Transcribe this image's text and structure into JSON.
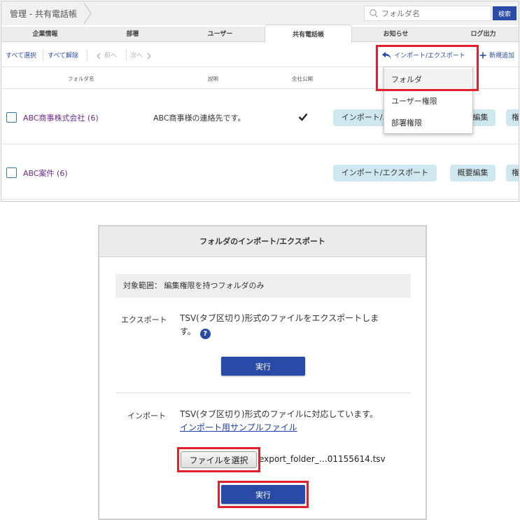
{
  "breadcrumb": "管理 - 共有電話帳",
  "search": {
    "placeholder": "フォルダ名",
    "button": "検索"
  },
  "tabs": [
    {
      "label": "企業情報"
    },
    {
      "label": "部署"
    },
    {
      "label": "ユーザー"
    },
    {
      "label": "共有電話帳",
      "active": true
    },
    {
      "label": "お知らせ"
    },
    {
      "label": "ログ出力"
    }
  ],
  "toolbar": {
    "select_all": "すべて選択",
    "deselect_all": "すべて解除",
    "prev": "前へ",
    "next": "次へ",
    "import_export": "インポート/エクスポート",
    "add_new": "新規追加"
  },
  "columns": {
    "folder_name": "フォルダ名",
    "description": "説明",
    "company_public": "全社公開"
  },
  "rows": [
    {
      "name": "ABC商事株式会社 (6)",
      "description": "ABC商事様の連絡先です。",
      "public": true,
      "import_export": "インポート/エクスポート",
      "summary_edit": "概要編集",
      "permission": "権"
    },
    {
      "name": "ABC案件 (6)",
      "description": "",
      "public": false,
      "import_export": "インポート/エクスポート",
      "summary_edit": "概要編集",
      "permission": "権"
    }
  ],
  "dropdown": [
    "フォルダ",
    "ユーザー権限",
    "部署権限"
  ],
  "modal": {
    "title": "フォルダのインポート/エクスポート",
    "scope": "対象範囲： 編集権限を持つフォルダのみ",
    "export_label": "エクスポート",
    "export_text_1": "TSV(タブ区切り)形式のファイルをエクスポートしま",
    "export_text_2": "す。",
    "help": "?",
    "export_button": "実行",
    "import_label": "インポート",
    "import_text": "TSV(タブ区切り)形式のファイルに対応しています。",
    "sample_link": "インポート用サンプルファイル",
    "file_button": "ファイルを選択",
    "file_name": "export_folder_…01155614.tsv",
    "import_button": "実行"
  },
  "colors": {
    "accent": "#2a4aa8",
    "highlight": "#e0202a",
    "pill": "#cfe7ee",
    "folder_link": "#6a2a8c"
  }
}
